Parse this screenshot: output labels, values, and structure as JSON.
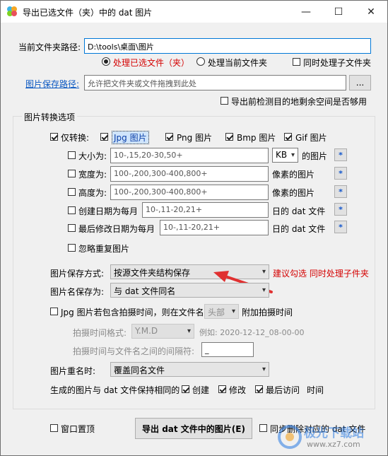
{
  "window": {
    "title": "导出已选文件（夹）中的 dat 图片",
    "controls": {
      "minimize": "—",
      "maximize": "☐",
      "close": "✕"
    }
  },
  "folder_path": {
    "label": "当前文件夹路径:",
    "value": "D:\\tools\\桌面\\图片"
  },
  "process_options": {
    "selected": {
      "label": "处理已选文件（夹）",
      "checked": true
    },
    "current_folder": {
      "label": "处理当前文件夹",
      "checked": false
    },
    "subfolders": {
      "label": "同时处理子文件夹",
      "checked": false
    }
  },
  "save_path": {
    "label": "图片保存路径:",
    "placeholder": "允许把文件夹或文件拖拽到此处",
    "browse_label": "..."
  },
  "check_space": {
    "label": "导出前检测目的地剩余空间是否够用",
    "checked": false
  },
  "convert_group": {
    "title": "图片转换选项",
    "only_convert": {
      "label": "仅转换:",
      "checked": true
    },
    "formats": [
      {
        "label": "Jpg 图片",
        "checked": true
      },
      {
        "label": "Png 图片",
        "checked": true
      },
      {
        "label": "Bmp 图片",
        "checked": true
      },
      {
        "label": "Gif 图片",
        "checked": true
      }
    ],
    "filters": {
      "size": {
        "label": "大小为:",
        "placeholder": "10-,15,20-30,50+",
        "unit": "KB",
        "suffix": "的图片",
        "star": "*"
      },
      "width": {
        "label": "宽度为:",
        "placeholder": "100-,200,300-400,800+",
        "suffix": "像素的图片",
        "star": "*"
      },
      "height": {
        "label": "高度为:",
        "placeholder": "100-,200,300-400,800+",
        "suffix": "像素的图片",
        "star": "*"
      },
      "created": {
        "label": "创建日期为每月",
        "placeholder": "10-,11-20,21+",
        "suffix": "日的 dat 文件",
        "star": "*"
      },
      "modified": {
        "label": "最后修改日期为每月",
        "placeholder": "10-,11-20,21+",
        "suffix": "日的 dat 文件",
        "star": "*"
      }
    },
    "ignore_dup": {
      "label": "忽略重复图片",
      "checked": false
    },
    "save_mode": {
      "label": "图片保存方式:",
      "value": "按源文件夹结构保存",
      "hint": "建议勾选 同时处理子件夹"
    },
    "name_as": {
      "label": "图片名保存为:",
      "value": "与 dat 文件同名"
    },
    "shot_time": {
      "label": "Jpg 图片若包含拍摄时间，则在文件名",
      "position": "头部",
      "suffix": "附加拍摄时间",
      "checked": false
    },
    "time_format": {
      "label": "拍摄时间格式:",
      "value": "Y.M.D",
      "example": "例如: 2020-12-12_08-00-00"
    },
    "separator": {
      "label": "拍摄时间与文件名之间的间隔符:",
      "value": "_"
    },
    "rename": {
      "label": "图片重名时:",
      "value": "覆盖同名文件"
    },
    "keep_times": {
      "label": "生成的图片与 dat 文件保持相同的",
      "created": {
        "label": "创建",
        "checked": true
      },
      "modified": {
        "label": "修改",
        "checked": true
      },
      "accessed": {
        "label": "最后访问",
        "checked": true
      },
      "tail": "时间"
    }
  },
  "bottom": {
    "topmost": {
      "label": "窗口置顶",
      "checked": false
    },
    "export_button": "导出 dat 文件中的图片(E)",
    "delete_sync": {
      "label": "同步删除对应的 dat 文件",
      "checked": false
    }
  },
  "watermark": {
    "text": "极光下载站",
    "url": "www.xz7.com"
  },
  "colors": {
    "accent_blue": "#0b58c2",
    "hint_red": "#d40000",
    "arrow_red": "#e03030"
  }
}
